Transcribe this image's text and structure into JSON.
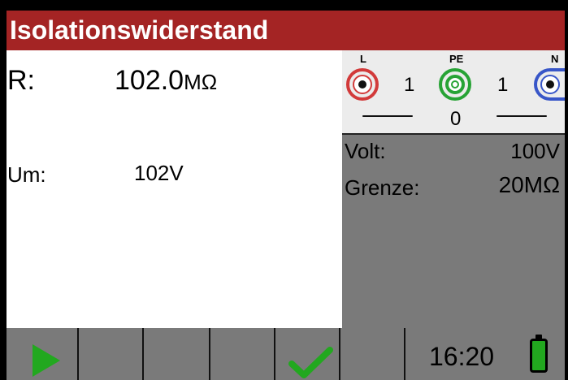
{
  "title": "Isolationswiderstand",
  "measurement": {
    "r_label": "R:",
    "r_value": "102.0",
    "r_unit": "MΩ",
    "um_label": "Um:",
    "um_value": "102V"
  },
  "terminals": {
    "l_label": "L",
    "pe_label": "PE",
    "n_label": "N",
    "l_pe_count": "1",
    "pe_n_count": "1",
    "l_n_count": "0",
    "colors": {
      "l": "#d23a3a",
      "pe": "#27a335",
      "n": "#3856c8"
    }
  },
  "settings": {
    "volt_label": "Volt:",
    "volt_value": "100V",
    "grenze_label": "Grenze:",
    "grenze_value": "20MΩ"
  },
  "footer": {
    "time": "16:20",
    "play_icon": "play-icon",
    "check_icon": "check-icon",
    "battery_icon": "battery-icon"
  },
  "colors": {
    "title_bar": "#a42424",
    "panel_gray": "#7a7a7a",
    "accent_green": "#22a81f"
  }
}
